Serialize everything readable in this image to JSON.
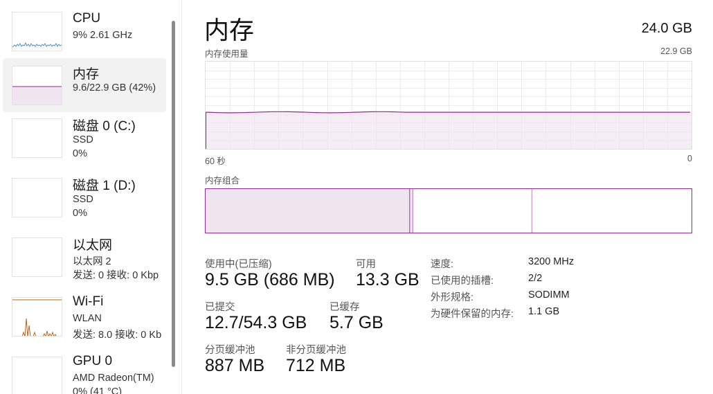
{
  "sidebar": {
    "items": [
      {
        "title": "CPU",
        "line1": "9% 2.61 GHz",
        "line2": ""
      },
      {
        "title": "内存",
        "line1": "9.6/22.9 GB (42%)",
        "line2": ""
      },
      {
        "title": "磁盘 0 (C:)",
        "line1": "SSD",
        "line2": "0%"
      },
      {
        "title": "磁盘 1 (D:)",
        "line1": "SSD",
        "line2": "0%"
      },
      {
        "title": "以太网",
        "line1": "以太网 2",
        "line2": "发送: 0 接收: 0 Kbp"
      },
      {
        "title": "Wi-Fi",
        "line1": "WLAN",
        "line2": "发送: 8.0 接收: 0 Kb"
      },
      {
        "title": "GPU 0",
        "line1": "AMD Radeon(TM)",
        "line2": "0% (41 °C)"
      }
    ]
  },
  "header": {
    "title": "内存",
    "total": "24.0 GB"
  },
  "usage_graph": {
    "label": "内存使用量",
    "max_label": "22.9 GB",
    "time_left": "60 秒",
    "time_right": "0",
    "usage_fraction": 0.42
  },
  "composition": {
    "label": "内存组合",
    "in_use_fraction": 0.42,
    "modified_fraction": 0.005,
    "standby_fraction": 0.245
  },
  "stats": {
    "in_use_label": "使用中(已压缩)",
    "in_use_value": "9.5 GB (686 MB)",
    "available_label": "可用",
    "available_value": "13.3 GB",
    "committed_label": "已提交",
    "committed_value": "12.7/54.3 GB",
    "cached_label": "已缓存",
    "cached_value": "5.7 GB",
    "paged_label": "分页缓冲池",
    "paged_value": "887 MB",
    "nonpaged_label": "非分页缓冲池",
    "nonpaged_value": "712 MB"
  },
  "details": [
    {
      "key": "速度:",
      "value": "3200 MHz"
    },
    {
      "key": "已使用的插槽:",
      "value": "2/2"
    },
    {
      "key": "外形规格:",
      "value": "SODIMM"
    },
    {
      "key": "为硬件保留的内存:",
      "value": "1.1 GB"
    }
  ],
  "colors": {
    "memory_accent": "#8b2d8b",
    "memory_fill": "#f1e4f1",
    "cpu_line": "#4a90c8",
    "wifi_line": "#b5651d"
  }
}
